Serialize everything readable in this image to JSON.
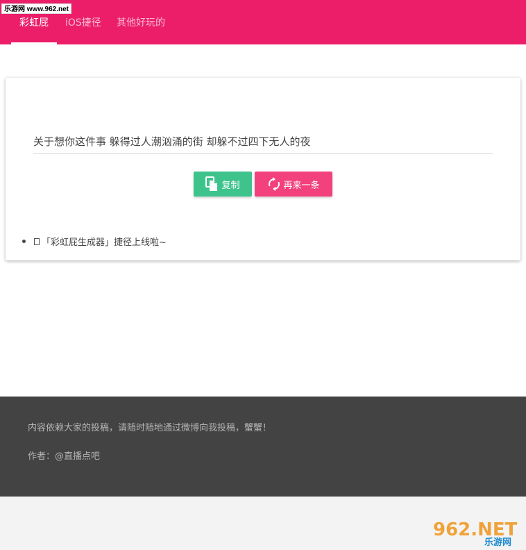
{
  "nav": {
    "tabs": [
      {
        "label": "彩虹屁",
        "active": true
      },
      {
        "label": "iOS捷径",
        "active": false
      },
      {
        "label": "其他好玩的",
        "active": false
      }
    ],
    "accent_color": "#ec1e69"
  },
  "watermark": {
    "top_text": "乐游网 www.962.net",
    "logo_main": "962.NET",
    "logo_sub": "乐游网"
  },
  "card": {
    "quote": "关于想你这件事 躲得过人潮汹涌的街 却躲不过四下无人的夜",
    "copy_button": {
      "label": "复制",
      "icon": "copy-icon",
      "color": "#3fc38d"
    },
    "next_button": {
      "label": "再来一条",
      "icon": "refresh-icon",
      "color": "#f2417c"
    },
    "notice": "「彩虹屁生成器」捷径上线啦~"
  },
  "footer": {
    "line1": "内容依赖大家的投稿，请随时随地通过微博向我投稿，蟹蟹！",
    "line2": "作者：@直播点吧"
  }
}
